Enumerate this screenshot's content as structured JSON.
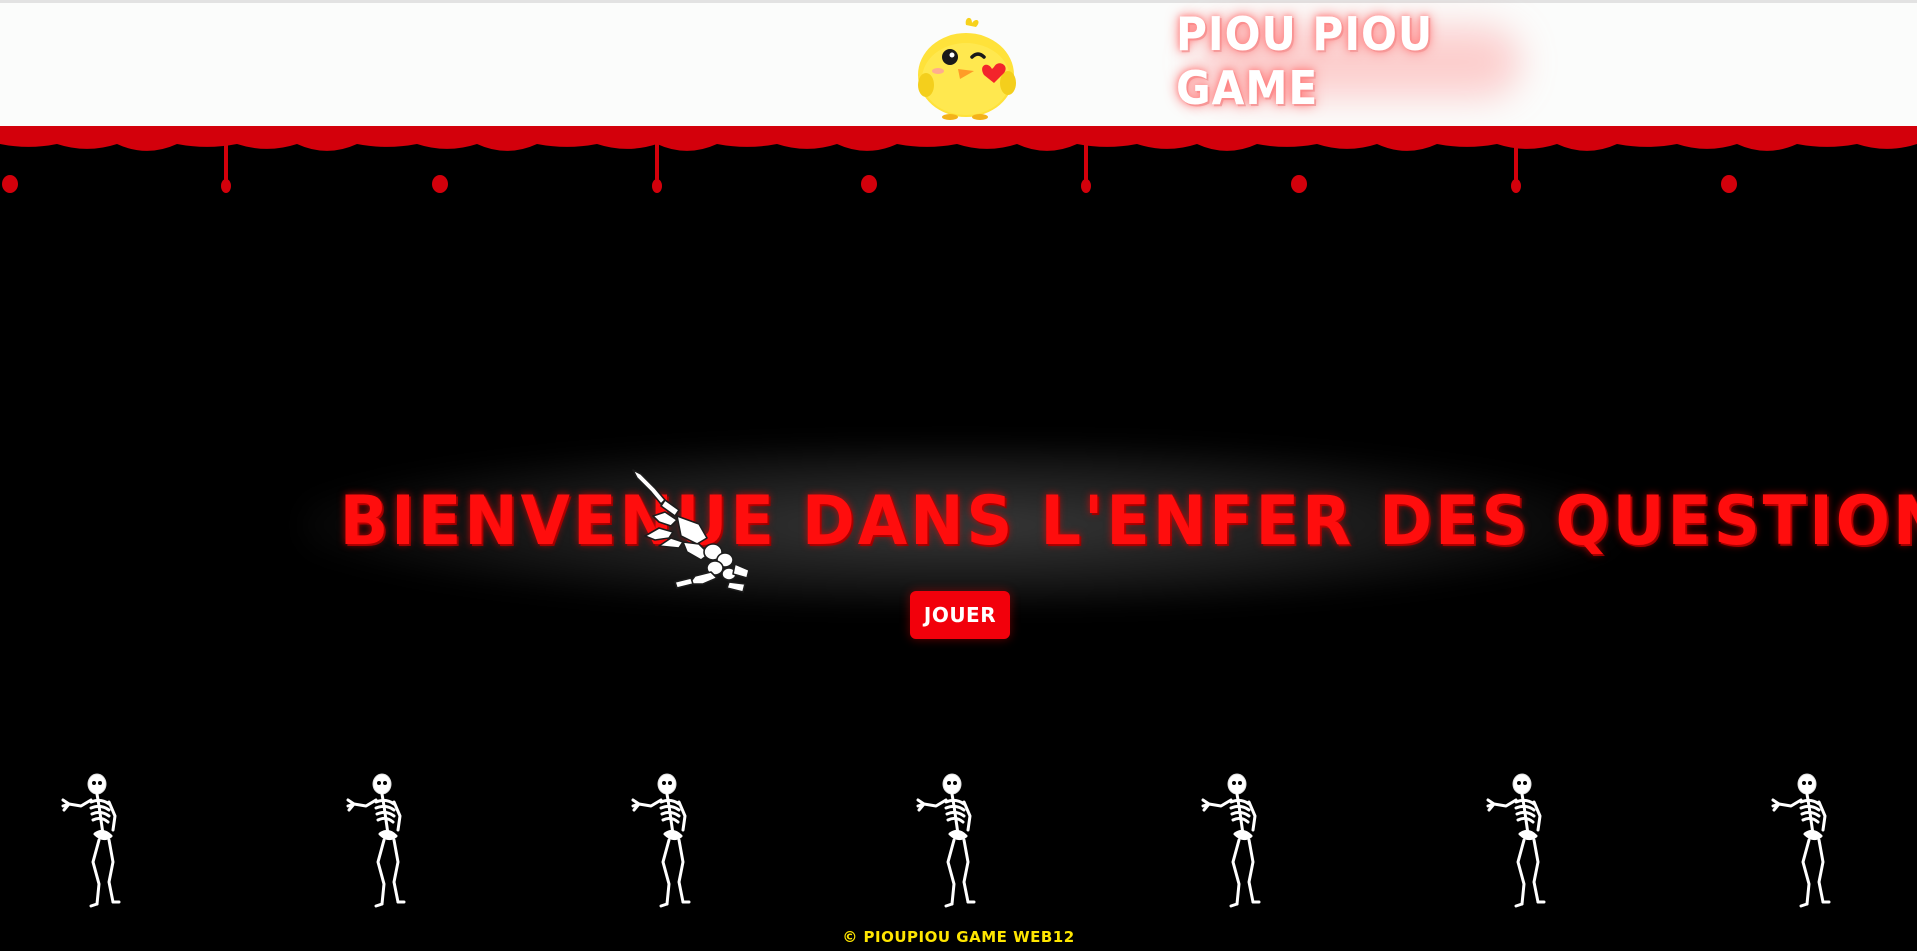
{
  "header": {
    "logo_icon": "chick-mascot-icon",
    "brand_title": "PIOU PIOU GAME",
    "background_color": "#fbfcfb"
  },
  "decor": {
    "blood_color": "#d3000b",
    "hand_icon": "skeleton-hand-icon",
    "skeleton_icon": "dancing-skeleton-icon",
    "skeleton_count": 7
  },
  "hero": {
    "title": "BIENVENUE DANS L'ENFER DES QUESTIONS",
    "title_color": "#ff0d0d",
    "play_label": "JOUER",
    "play_color": "#f2000b"
  },
  "footer": {
    "copyright": "© PIOUPIOU GAME WEB12",
    "color": "#ffe600"
  }
}
